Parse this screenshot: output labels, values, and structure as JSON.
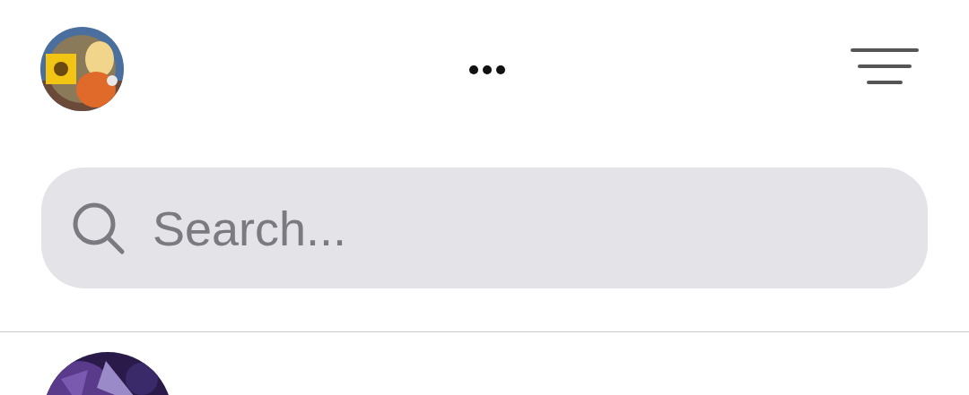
{
  "search": {
    "placeholder": "Search..."
  }
}
